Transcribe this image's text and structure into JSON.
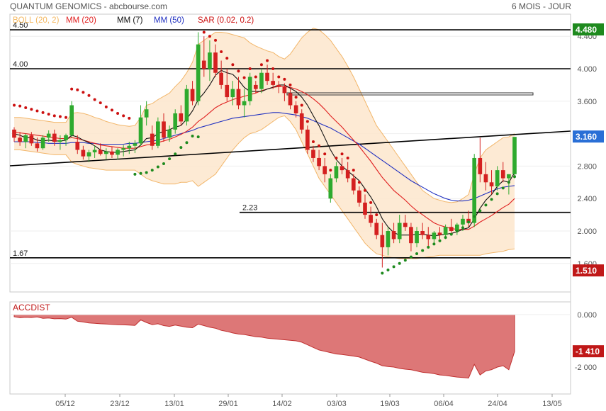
{
  "header": {
    "title": "QUANTUM GENOMICS - abcbourse.com",
    "period": "6 MOIS - JOUR"
  },
  "legend": [
    {
      "label": "BOLL (20, 2)",
      "color": "#f4b860"
    },
    {
      "label": "MM (20)",
      "color": "#e02020"
    },
    {
      "label": "MM (7)",
      "color": "#111111"
    },
    {
      "label": "MM (50)",
      "color": "#2030c0"
    },
    {
      "label": "SAR (0.02, 0.2)",
      "color": "#cc1010"
    }
  ],
  "price_axis": {
    "ticks": [
      "4.400",
      "4.000",
      "3.600",
      "3.200",
      "2.800",
      "2.400",
      "2.000",
      "1.600"
    ],
    "ylim": [
      1.3,
      4.5
    ]
  },
  "levels": [
    {
      "label": "4.50",
      "value": 4.48,
      "badge": "4.480",
      "badge_color": "#1e8a1e"
    },
    {
      "label": "4.00",
      "value": 4.0
    },
    {
      "label": "2.23",
      "value": 2.23
    },
    {
      "label": "1.67",
      "value": 1.67
    }
  ],
  "badges": [
    {
      "text": "3.160",
      "value": 3.16,
      "color": "#2a6fd6"
    },
    {
      "text": "1.510",
      "value": 1.51,
      "color": "#c01818"
    }
  ],
  "x_axis": {
    "labels": [
      "05/12",
      "23/12",
      "13/01",
      "29/01",
      "14/02",
      "03/03",
      "19/03",
      "06/04",
      "24/04",
      "13/05"
    ]
  },
  "accdist": {
    "title": "ACCDIST",
    "ticks": [
      "0.000",
      "-2 000"
    ],
    "current_badge": "-1 410",
    "badge_color": "#c01818"
  },
  "chart_data": [
    {
      "type": "candlestick",
      "title": "QUANTUM GENOMICS",
      "x_labels": [
        "05/12",
        "23/12",
        "13/01",
        "29/01",
        "14/02",
        "03/03",
        "19/03",
        "06/04",
        "24/04",
        "13/05"
      ],
      "ohlc": [
        [
          3.25,
          3.28,
          3.1,
          3.15
        ],
        [
          3.15,
          3.22,
          3.05,
          3.1
        ],
        [
          3.1,
          3.2,
          3.02,
          3.18
        ],
        [
          3.18,
          3.22,
          3.05,
          3.08
        ],
        [
          3.08,
          3.15,
          2.98,
          3.02
        ],
        [
          3.02,
          3.18,
          3.0,
          3.15
        ],
        [
          3.15,
          3.24,
          3.1,
          3.2
        ],
        [
          3.2,
          3.25,
          3.05,
          3.1
        ],
        [
          3.1,
          3.18,
          3.0,
          3.12
        ],
        [
          3.12,
          3.2,
          3.05,
          3.18
        ],
        [
          3.18,
          3.6,
          3.15,
          3.55
        ],
        [
          3.1,
          3.18,
          2.95,
          3.0
        ],
        [
          3.0,
          3.05,
          2.88,
          2.92
        ],
        [
          2.92,
          3.0,
          2.85,
          2.97
        ],
        [
          2.97,
          3.05,
          2.9,
          3.0
        ],
        [
          3.0,
          3.08,
          2.93,
          2.95
        ],
        [
          2.95,
          3.02,
          2.88,
          2.98
        ],
        [
          2.98,
          3.04,
          2.9,
          2.94
        ],
        [
          2.94,
          3.02,
          2.88,
          3.0
        ],
        [
          3.0,
          3.06,
          2.92,
          3.02
        ],
        [
          3.02,
          3.1,
          2.95,
          3.05
        ],
        [
          3.05,
          3.12,
          2.96,
          3.08
        ],
        [
          3.08,
          3.55,
          3.05,
          3.4
        ],
        [
          3.4,
          3.6,
          3.3,
          3.5
        ],
        [
          3.2,
          3.3,
          3.0,
          3.05
        ],
        [
          3.05,
          3.4,
          3.02,
          3.35
        ],
        [
          3.35,
          3.45,
          3.1,
          3.15
        ],
        [
          3.15,
          3.3,
          3.1,
          3.25
        ],
        [
          3.25,
          3.5,
          3.2,
          3.45
        ],
        [
          3.45,
          3.55,
          3.3,
          3.35
        ],
        [
          3.35,
          3.8,
          3.3,
          3.75
        ],
        [
          3.75,
          3.85,
          3.55,
          3.6
        ],
        [
          3.6,
          4.45,
          3.55,
          4.3
        ],
        [
          4.1,
          4.4,
          3.9,
          4.0
        ],
        [
          4.0,
          4.35,
          3.85,
          4.2
        ],
        [
          4.2,
          4.3,
          3.9,
          3.95
        ],
        [
          3.95,
          4.1,
          3.75,
          3.8
        ],
        [
          3.8,
          4.0,
          3.6,
          3.65
        ],
        [
          3.65,
          3.85,
          3.55,
          3.75
        ],
        [
          3.75,
          3.9,
          3.5,
          3.55
        ],
        [
          3.55,
          3.75,
          3.4,
          3.6
        ],
        [
          3.6,
          3.95,
          3.55,
          3.9
        ],
        [
          3.8,
          3.85,
          3.7,
          3.75
        ],
        [
          3.75,
          4.0,
          3.7,
          3.95
        ],
        [
          3.95,
          4.05,
          3.8,
          3.85
        ],
        [
          3.85,
          3.95,
          3.75,
          3.8
        ],
        [
          3.8,
          3.85,
          3.7,
          3.78
        ],
        [
          3.78,
          3.82,
          3.6,
          3.7
        ],
        [
          3.7,
          3.75,
          3.5,
          3.55
        ],
        [
          3.55,
          3.6,
          3.4,
          3.45
        ],
        [
          3.45,
          3.5,
          3.2,
          3.25
        ],
        [
          3.25,
          3.3,
          2.95,
          3.0
        ],
        [
          3.0,
          3.05,
          2.85,
          2.9
        ],
        [
          2.9,
          3.0,
          2.75,
          2.8
        ],
        [
          2.8,
          2.9,
          2.6,
          2.7
        ],
        [
          2.4,
          2.7,
          2.35,
          2.65
        ],
        [
          2.65,
          2.85,
          2.6,
          2.8
        ],
        [
          2.8,
          2.9,
          2.7,
          2.75
        ],
        [
          2.75,
          2.85,
          2.6,
          2.65
        ],
        [
          2.65,
          2.7,
          2.45,
          2.5
        ],
        [
          2.5,
          2.55,
          2.3,
          2.35
        ],
        [
          2.35,
          2.45,
          2.15,
          2.2
        ],
        [
          2.2,
          2.3,
          2.05,
          2.1
        ],
        [
          2.1,
          2.15,
          1.9,
          1.95
        ],
        [
          1.95,
          2.1,
          1.55,
          1.8
        ],
        [
          1.8,
          2.05,
          1.7,
          2.0
        ],
        [
          2.0,
          2.1,
          1.85,
          1.9
        ],
        [
          1.9,
          2.2,
          1.85,
          2.1
        ],
        [
          2.1,
          2.2,
          2.0,
          2.05
        ],
        [
          2.05,
          2.1,
          1.75,
          1.85
        ],
        [
          1.85,
          2.05,
          1.8,
          2.0
        ],
        [
          2.0,
          2.1,
          1.9,
          1.95
        ],
        [
          1.95,
          2.05,
          1.8,
          1.9
        ],
        [
          1.9,
          2.0,
          1.85,
          1.98
        ],
        [
          1.98,
          2.05,
          1.9,
          1.95
        ],
        [
          1.95,
          2.08,
          1.9,
          2.05
        ],
        [
          2.05,
          2.15,
          1.98,
          2.0
        ],
        [
          2.0,
          2.1,
          1.95,
          2.08
        ],
        [
          2.08,
          2.2,
          2.0,
          2.15
        ],
        [
          2.15,
          2.25,
          2.05,
          2.1
        ],
        [
          2.1,
          2.95,
          2.05,
          2.9
        ],
        [
          2.9,
          3.15,
          2.6,
          2.7
        ],
        [
          2.7,
          2.85,
          2.5,
          2.6
        ],
        [
          2.6,
          2.75,
          2.45,
          2.55
        ],
        [
          2.55,
          2.8,
          2.5,
          2.75
        ],
        [
          2.75,
          2.85,
          2.6,
          2.65
        ],
        [
          2.65,
          2.7,
          2.45,
          2.7
        ],
        [
          2.7,
          3.15,
          2.65,
          3.16
        ]
      ],
      "ma7": [
        3.2,
        3.18,
        3.15,
        3.15,
        3.12,
        3.11,
        3.12,
        3.11,
        3.11,
        3.12,
        3.18,
        3.16,
        3.12,
        3.09,
        3.05,
        3.0,
        2.98,
        2.97,
        2.97,
        2.98,
        2.99,
        3.0,
        3.06,
        3.14,
        3.15,
        3.2,
        3.23,
        3.25,
        3.28,
        3.3,
        3.38,
        3.48,
        3.62,
        3.7,
        3.8,
        3.92,
        3.98,
        3.95,
        3.93,
        3.86,
        3.77,
        3.72,
        3.72,
        3.72,
        3.75,
        3.77,
        3.8,
        3.8,
        3.76,
        3.72,
        3.65,
        3.55,
        3.42,
        3.3,
        3.15,
        3.0,
        2.88,
        2.8,
        2.74,
        2.68,
        2.62,
        2.52,
        2.42,
        2.3,
        2.15,
        2.05,
        1.98,
        1.95,
        1.95,
        1.95,
        1.96,
        1.96,
        1.95,
        1.94,
        1.95,
        1.96,
        1.97,
        1.99,
        2.02,
        2.04,
        2.15,
        2.28,
        2.38,
        2.45,
        2.55,
        2.62,
        2.6,
        2.72
      ],
      "ma20": [
        3.22,
        3.21,
        3.2,
        3.19,
        3.18,
        3.17,
        3.16,
        3.15,
        3.14,
        3.14,
        3.15,
        3.14,
        3.12,
        3.1,
        3.08,
        3.06,
        3.05,
        3.04,
        3.03,
        3.02,
        3.02,
        3.02,
        3.04,
        3.06,
        3.07,
        3.09,
        3.11,
        3.13,
        3.16,
        3.19,
        3.23,
        3.28,
        3.35,
        3.4,
        3.46,
        3.52,
        3.56,
        3.59,
        3.62,
        3.64,
        3.66,
        3.68,
        3.7,
        3.73,
        3.75,
        3.77,
        3.78,
        3.78,
        3.77,
        3.75,
        3.72,
        3.68,
        3.63,
        3.57,
        3.5,
        3.42,
        3.35,
        3.28,
        3.2,
        3.12,
        3.04,
        2.95,
        2.86,
        2.76,
        2.66,
        2.58,
        2.5,
        2.44,
        2.38,
        2.31,
        2.25,
        2.2,
        2.15,
        2.1,
        2.07,
        2.05,
        2.03,
        2.02,
        2.02,
        2.02,
        2.06,
        2.11,
        2.15,
        2.19,
        2.24,
        2.29,
        2.33,
        2.4
      ],
      "ma50": [
        3.1,
        3.1,
        3.1,
        3.1,
        3.09,
        3.09,
        3.08,
        3.08,
        3.08,
        3.08,
        3.09,
        3.09,
        3.09,
        3.08,
        3.08,
        3.07,
        3.07,
        3.07,
        3.07,
        3.07,
        3.08,
        3.08,
        3.09,
        3.1,
        3.11,
        3.12,
        3.14,
        3.16,
        3.18,
        3.2,
        3.22,
        3.24,
        3.27,
        3.29,
        3.31,
        3.33,
        3.35,
        3.37,
        3.39,
        3.4,
        3.41,
        3.42,
        3.43,
        3.44,
        3.45,
        3.46,
        3.46,
        3.45,
        3.44,
        3.43,
        3.41,
        3.39,
        3.36,
        3.33,
        3.3,
        3.27,
        3.23,
        3.19,
        3.15,
        3.11,
        3.07,
        3.02,
        2.97,
        2.92,
        2.87,
        2.82,
        2.77,
        2.72,
        2.67,
        2.62,
        2.58,
        2.54,
        2.5,
        2.46,
        2.43,
        2.4,
        2.38,
        2.37,
        2.37,
        2.38,
        2.4,
        2.43,
        2.46,
        2.49,
        2.52,
        2.54,
        2.55,
        2.56
      ],
      "boll_upper": [
        3.4,
        3.4,
        3.39,
        3.38,
        3.37,
        3.36,
        3.35,
        3.34,
        3.34,
        3.34,
        3.45,
        3.46,
        3.45,
        3.43,
        3.4,
        3.38,
        3.35,
        3.33,
        3.31,
        3.3,
        3.29,
        3.3,
        3.4,
        3.55,
        3.57,
        3.62,
        3.66,
        3.7,
        3.78,
        3.85,
        3.95,
        4.08,
        4.3,
        4.35,
        4.4,
        4.45,
        4.45,
        4.44,
        4.42,
        4.4,
        4.38,
        4.32,
        4.28,
        4.25,
        4.22,
        4.2,
        4.15,
        4.12,
        4.18,
        4.28,
        4.38,
        4.45,
        4.5,
        4.48,
        4.42,
        4.35,
        4.25,
        4.15,
        4.03,
        3.9,
        3.75,
        3.6,
        3.45,
        3.3,
        3.2,
        3.1,
        3.0,
        2.9,
        2.8,
        2.7,
        2.6,
        2.5,
        2.45,
        2.4,
        2.38,
        2.36,
        2.35,
        2.36,
        2.4,
        2.45,
        2.7,
        2.9,
        3.0,
        3.05,
        3.1,
        3.15,
        3.16,
        3.2
      ],
      "boll_lower": [
        3.0,
        3.0,
        2.99,
        2.98,
        2.97,
        2.96,
        2.95,
        2.94,
        2.94,
        2.94,
        2.85,
        2.82,
        2.8,
        2.78,
        2.77,
        2.76,
        2.75,
        2.75,
        2.75,
        2.75,
        2.75,
        2.75,
        2.7,
        2.65,
        2.62,
        2.6,
        2.58,
        2.58,
        2.58,
        2.6,
        2.6,
        2.62,
        2.55,
        2.6,
        2.65,
        2.7,
        2.8,
        2.9,
        3.0,
        3.08,
        3.15,
        3.2,
        3.22,
        3.25,
        3.3,
        3.35,
        3.4,
        3.42,
        3.35,
        3.25,
        3.1,
        2.95,
        2.8,
        2.65,
        2.55,
        2.45,
        2.35,
        2.25,
        2.15,
        2.05,
        1.95,
        1.85,
        1.78,
        1.72,
        1.7,
        1.68,
        1.67,
        1.66,
        1.66,
        1.66,
        1.66,
        1.67,
        1.68,
        1.69,
        1.7,
        1.7,
        1.7,
        1.7,
        1.7,
        1.7,
        1.7,
        1.7,
        1.72,
        1.73,
        1.74,
        1.75,
        1.77,
        1.78
      ]
    },
    {
      "type": "area",
      "title": "ACCDIST",
      "ylim": [
        -2600,
        100
      ],
      "values": [
        -80,
        -120,
        -100,
        -110,
        -90,
        -140,
        -130,
        -160,
        -150,
        -170,
        -100,
        -250,
        -280,
        -320,
        -330,
        -350,
        -360,
        -370,
        -380,
        -390,
        -400,
        -410,
        -200,
        -300,
        -380,
        -350,
        -420,
        -450,
        -400,
        -440,
        -480,
        -500,
        -360,
        -420,
        -480,
        -520,
        -600,
        -640,
        -700,
        -740,
        -760,
        -800,
        -840,
        -860,
        -900,
        -920,
        -940,
        -960,
        -980,
        -1000,
        -1050,
        -1150,
        -1250,
        -1350,
        -1400,
        -1450,
        -1500,
        -1520,
        -1550,
        -1580,
        -1620,
        -1700,
        -1780,
        -1850,
        -1950,
        -1980,
        -2000,
        -2050,
        -2080,
        -2100,
        -2150,
        -2200,
        -2220,
        -2250,
        -2300,
        -2320,
        -2350,
        -2380,
        -2400,
        -2420,
        -1900,
        -2300,
        -2150,
        -2100,
        -2000,
        -1950,
        -2100,
        -1410
      ]
    }
  ]
}
